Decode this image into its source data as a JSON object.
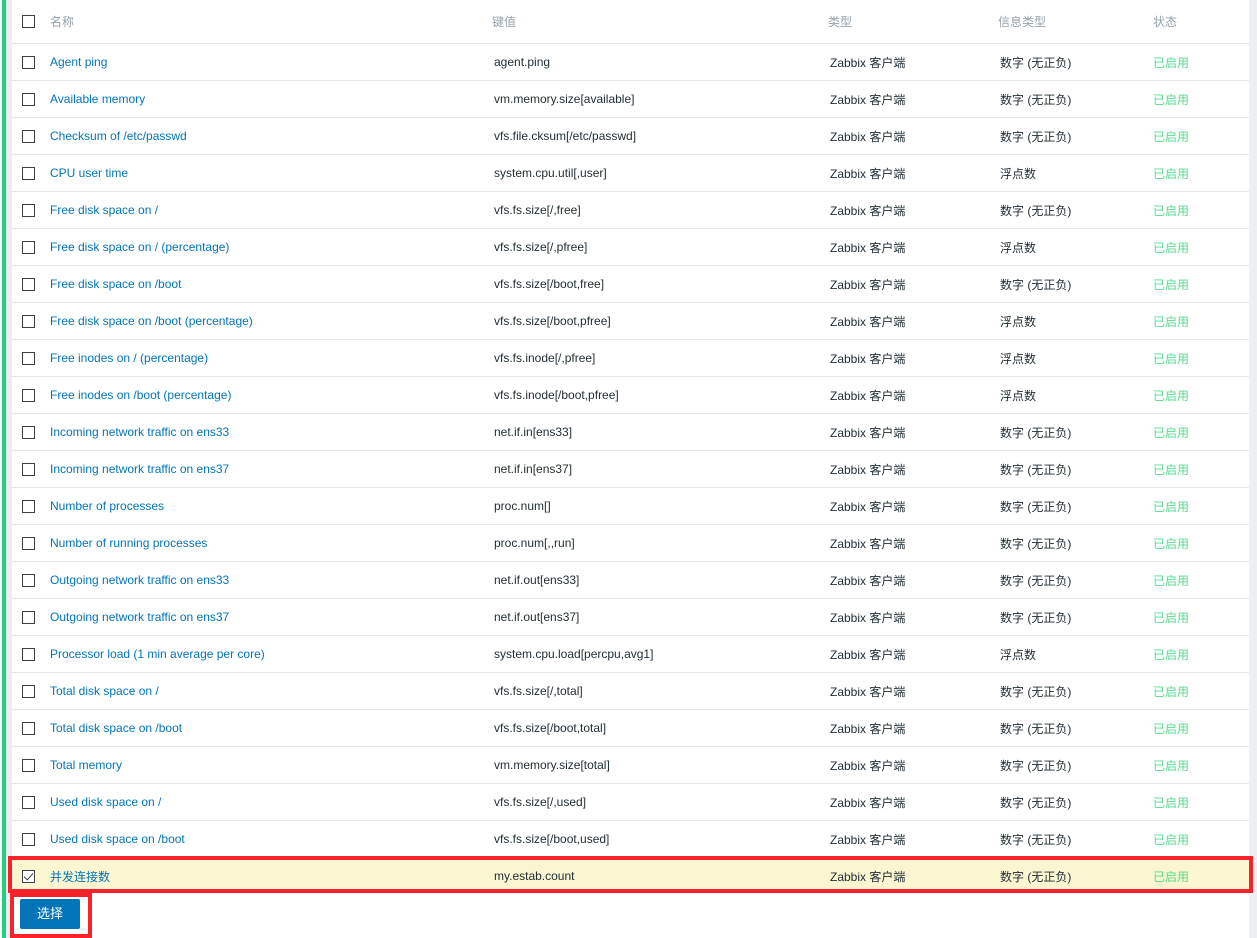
{
  "dialog": {
    "table": {
      "columns": [
        {
          "key": "name",
          "label": "名称"
        },
        {
          "key": "key_",
          "label": "键值"
        },
        {
          "key": "type",
          "label": "类型"
        },
        {
          "key": "value_type",
          "label": "信息类型"
        },
        {
          "key": "status",
          "label": "状态"
        }
      ],
      "select_all_checked": false,
      "rows": [
        {
          "name": "Agent ping",
          "key_": "agent.ping",
          "type": "Zabbix 客户端",
          "value_type": "数字 (无正负)",
          "status": "已启用",
          "checked": false,
          "highlighted": false
        },
        {
          "name": "Available memory",
          "key_": "vm.memory.size[available]",
          "type": "Zabbix 客户端",
          "value_type": "数字 (无正负)",
          "status": "已启用",
          "checked": false,
          "highlighted": false
        },
        {
          "name": "Checksum of /etc/passwd",
          "key_": "vfs.file.cksum[/etc/passwd]",
          "type": "Zabbix 客户端",
          "value_type": "数字 (无正负)",
          "status": "已启用",
          "checked": false,
          "highlighted": false
        },
        {
          "name": "CPU user time",
          "key_": "system.cpu.util[,user]",
          "type": "Zabbix 客户端",
          "value_type": "浮点数",
          "status": "已启用",
          "checked": false,
          "highlighted": false
        },
        {
          "name": "Free disk space on /",
          "key_": "vfs.fs.size[/,free]",
          "type": "Zabbix 客户端",
          "value_type": "数字 (无正负)",
          "status": "已启用",
          "checked": false,
          "highlighted": false
        },
        {
          "name": "Free disk space on / (percentage)",
          "key_": "vfs.fs.size[/,pfree]",
          "type": "Zabbix 客户端",
          "value_type": "浮点数",
          "status": "已启用",
          "checked": false,
          "highlighted": false
        },
        {
          "name": "Free disk space on /boot",
          "key_": "vfs.fs.size[/boot,free]",
          "type": "Zabbix 客户端",
          "value_type": "数字 (无正负)",
          "status": "已启用",
          "checked": false,
          "highlighted": false
        },
        {
          "name": "Free disk space on /boot (percentage)",
          "key_": "vfs.fs.size[/boot,pfree]",
          "type": "Zabbix 客户端",
          "value_type": "浮点数",
          "status": "已启用",
          "checked": false,
          "highlighted": false
        },
        {
          "name": "Free inodes on / (percentage)",
          "key_": "vfs.fs.inode[/,pfree]",
          "type": "Zabbix 客户端",
          "value_type": "浮点数",
          "status": "已启用",
          "checked": false,
          "highlighted": false
        },
        {
          "name": "Free inodes on /boot (percentage)",
          "key_": "vfs.fs.inode[/boot,pfree]",
          "type": "Zabbix 客户端",
          "value_type": "浮点数",
          "status": "已启用",
          "checked": false,
          "highlighted": false
        },
        {
          "name": "Incoming network traffic on ens33",
          "key_": "net.if.in[ens33]",
          "type": "Zabbix 客户端",
          "value_type": "数字 (无正负)",
          "status": "已启用",
          "checked": false,
          "highlighted": false
        },
        {
          "name": "Incoming network traffic on ens37",
          "key_": "net.if.in[ens37]",
          "type": "Zabbix 客户端",
          "value_type": "数字 (无正负)",
          "status": "已启用",
          "checked": false,
          "highlighted": false
        },
        {
          "name": "Number of processes",
          "key_": "proc.num[]",
          "type": "Zabbix 客户端",
          "value_type": "数字 (无正负)",
          "status": "已启用",
          "checked": false,
          "highlighted": false
        },
        {
          "name": "Number of running processes",
          "key_": "proc.num[,,run]",
          "type": "Zabbix 客户端",
          "value_type": "数字 (无正负)",
          "status": "已启用",
          "checked": false,
          "highlighted": false
        },
        {
          "name": "Outgoing network traffic on ens33",
          "key_": "net.if.out[ens33]",
          "type": "Zabbix 客户端",
          "value_type": "数字 (无正负)",
          "status": "已启用",
          "checked": false,
          "highlighted": false
        },
        {
          "name": "Outgoing network traffic on ens37",
          "key_": "net.if.out[ens37]",
          "type": "Zabbix 客户端",
          "value_type": "数字 (无正负)",
          "status": "已启用",
          "checked": false,
          "highlighted": false
        },
        {
          "name": "Processor load (1 min average per core)",
          "key_": "system.cpu.load[percpu,avg1]",
          "type": "Zabbix 客户端",
          "value_type": "浮点数",
          "status": "已启用",
          "checked": false,
          "highlighted": false
        },
        {
          "name": "Total disk space on /",
          "key_": "vfs.fs.size[/,total]",
          "type": "Zabbix 客户端",
          "value_type": "数字 (无正负)",
          "status": "已启用",
          "checked": false,
          "highlighted": false
        },
        {
          "name": "Total disk space on /boot",
          "key_": "vfs.fs.size[/boot,total]",
          "type": "Zabbix 客户端",
          "value_type": "数字 (无正负)",
          "status": "已启用",
          "checked": false,
          "highlighted": false
        },
        {
          "name": "Total memory",
          "key_": "vm.memory.size[total]",
          "type": "Zabbix 客户端",
          "value_type": "数字 (无正负)",
          "status": "已启用",
          "checked": false,
          "highlighted": false
        },
        {
          "name": "Used disk space on /",
          "key_": "vfs.fs.size[/,used]",
          "type": "Zabbix 客户端",
          "value_type": "数字 (无正负)",
          "status": "已启用",
          "checked": false,
          "highlighted": false
        },
        {
          "name": "Used disk space on /boot",
          "key_": "vfs.fs.size[/boot,used]",
          "type": "Zabbix 客户端",
          "value_type": "数字 (无正负)",
          "status": "已启用",
          "checked": false,
          "highlighted": false
        },
        {
          "name": "并发连接数",
          "key_": "my.estab.count",
          "type": "Zabbix 客户端",
          "value_type": "数字 (无正负)",
          "status": "已启用",
          "checked": true,
          "highlighted": true
        }
      ]
    },
    "footer": {
      "select_button_label": "选择"
    }
  },
  "colors": {
    "link": "#0275b8",
    "status_enabled": "#59db8f",
    "highlight_row_bg": "#faf6d2",
    "annotation": "#f8232a",
    "button_primary": "#0275b8",
    "accent_green": "#20d07f"
  }
}
